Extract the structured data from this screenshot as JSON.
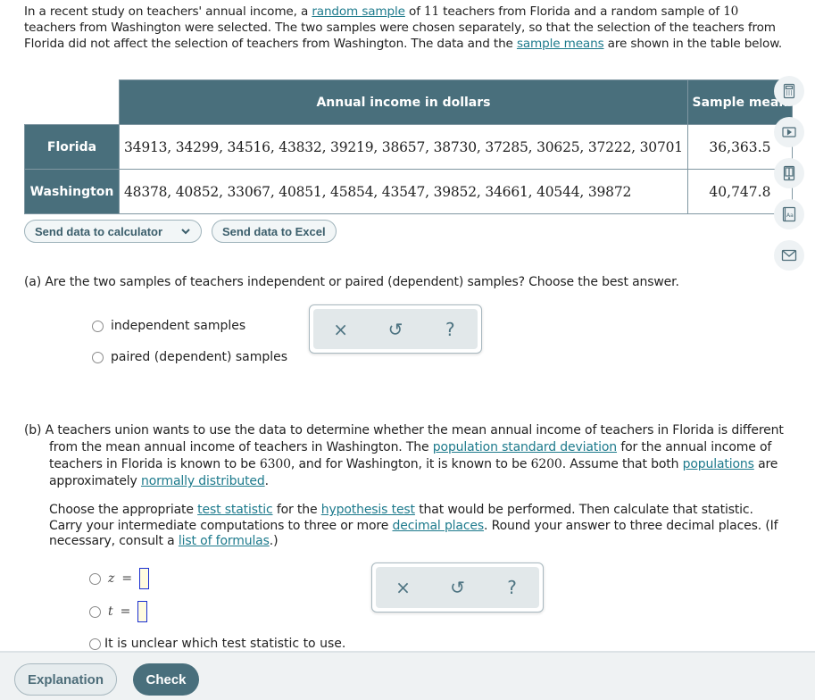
{
  "intro": {
    "part1": "In a recent study on teachers' annual income, a ",
    "link1": "random sample",
    "part2": " of ",
    "n1": "11",
    "part3": " teachers from Florida and a random sample of ",
    "n2": "10",
    "part4": " teachers from Washington were selected. The two samples were chosen separately, so that the selection of the teachers from Florida did not affect the selection of teachers from Washington. The data and the ",
    "link2": "sample means",
    "part5": " are shown in the table below."
  },
  "table": {
    "header_values": "Annual income in dollars",
    "header_mean": "Sample mean",
    "rows": [
      {
        "label": "Florida",
        "values": "34913, 34299, 34516, 43832, 39219, 38657, 38730, 37285, 30625, 37222, 30701",
        "mean": "36,363.5"
      },
      {
        "label": "Washington",
        "values": "48378, 40852, 33067, 40851, 45854, 43547, 39852, 34661, 40544, 39872",
        "mean": "40,747.8"
      }
    ]
  },
  "buttons": {
    "send_calculator": "Send data to calculator",
    "send_excel": "Send data to Excel",
    "explanation": "Explanation",
    "check": "Check"
  },
  "sidebar": {
    "items": [
      {
        "icon": "calculator-icon"
      },
      {
        "icon": "video-icon"
      },
      {
        "icon": "ebook-icon"
      },
      {
        "icon": "glossary-icon"
      },
      {
        "icon": "mail-icon"
      }
    ]
  },
  "part_a": {
    "question": "(a) Are the two samples of teachers independent or paired (dependent) samples? Choose the best answer.",
    "options": [
      "independent samples",
      "paired (dependent) samples"
    ]
  },
  "part_b": {
    "p1_a": "(b) A teachers union wants to use the data to determine whether the mean annual income of teachers in Florida is different from the mean annual income of teachers in Washington. The ",
    "p1_link1": "population standard deviation",
    "p1_b": " for the annual income of teachers in Florida is known to be ",
    "sd1": "6300",
    "p1_c": ", and for Washington, it is known to be ",
    "sd2": "6200",
    "p1_d": ". Assume that both ",
    "p1_link2": "populations",
    "p1_e": " are approximately ",
    "p1_link3": "normally distributed",
    "p1_f": ".",
    "p2_a": "Choose the appropriate ",
    "p2_link1": "test statistic",
    "p2_b": " for the ",
    "p2_link2": "hypothesis test",
    "p2_c": " that would be performed. Then calculate that statistic. Carry your intermediate computations to three or more ",
    "p2_link3": "decimal places",
    "p2_d": ". Round your answer to three decimal places. (If necessary, consult a ",
    "p2_link4": "list of formulas",
    "p2_e": ".)",
    "opt_z": "z",
    "opt_t": "t",
    "equals": "=",
    "opt_unclear": "It is unclear which test statistic to use."
  },
  "toolbox": {
    "clear": "×",
    "undo": "↺",
    "help": "?"
  }
}
